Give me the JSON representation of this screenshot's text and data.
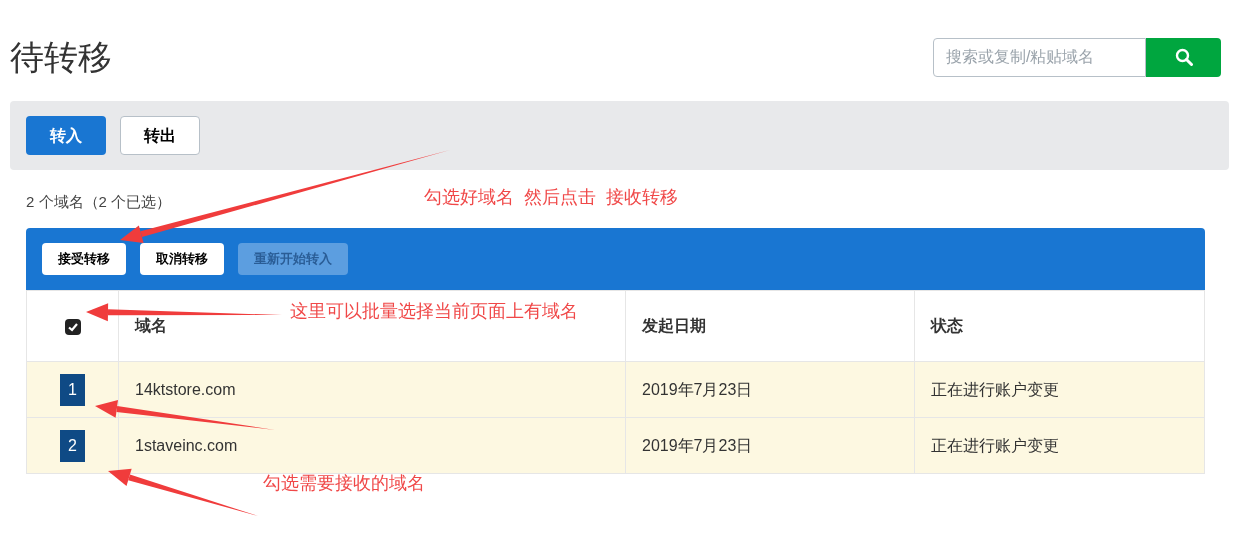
{
  "title": "待转移",
  "search": {
    "placeholder": "搜索或复制/粘贴域名"
  },
  "tabs": [
    {
      "label": "转入",
      "selected": true
    },
    {
      "label": "转出",
      "selected": false
    }
  ],
  "summary": "2 个域名（2 个已选）",
  "actions": [
    {
      "label": "接受转移",
      "disabled": false
    },
    {
      "label": "取消转移",
      "disabled": false
    },
    {
      "label": "重新开始转入",
      "disabled": true
    }
  ],
  "table": {
    "select_all": {
      "checked": true
    },
    "columns": [
      "域名",
      "发起日期",
      "状态"
    ],
    "rows": [
      {
        "badge": "1",
        "selected": true,
        "cells": [
          "14ktstore.com",
          "2019年7月23日",
          "正在进行账户变更"
        ]
      },
      {
        "badge": "2",
        "selected": true,
        "cells": [
          "1staveinc.com",
          "2019年7月23日",
          "正在进行账户变更"
        ]
      }
    ]
  },
  "annotations": [
    {
      "text": "勾选好域名  然后点击  接收转移"
    },
    {
      "text": "这里可以批量选择当前页面上有域名"
    },
    {
      "text": "勾选需要接收的域名"
    }
  ]
}
